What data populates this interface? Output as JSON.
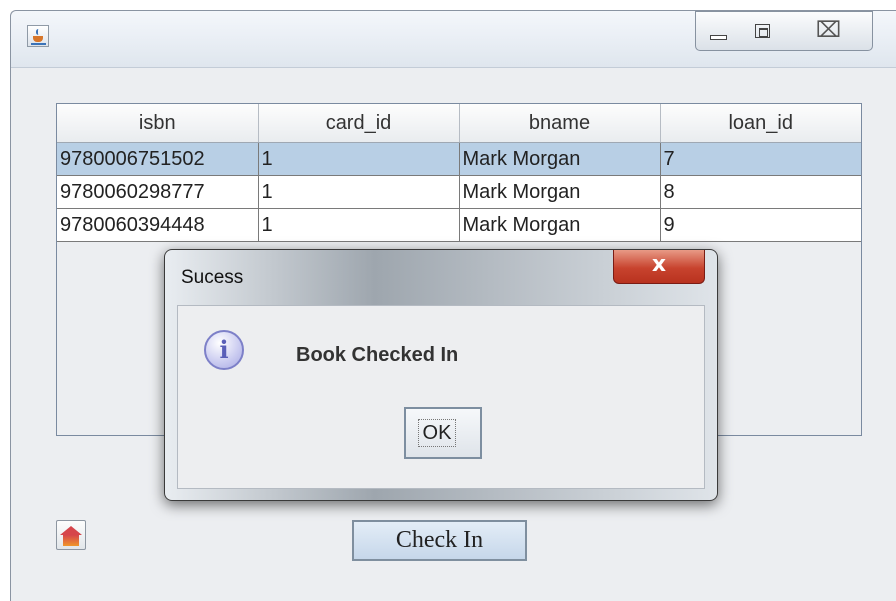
{
  "window": {
    "icon": "java-cup-icon",
    "controls": {
      "minimize": "minimize-icon",
      "maximize": "maximize-icon",
      "close_glyph": "⌧"
    }
  },
  "table": {
    "headers": [
      "isbn",
      "card_id",
      "bname",
      "loan_id"
    ],
    "rows": [
      {
        "isbn": "9780006751502",
        "card_id": "1",
        "bname": "Mark Morgan",
        "loan_id": "7",
        "selected": true
      },
      {
        "isbn": "9780060298777",
        "card_id": "1",
        "bname": "Mark Morgan",
        "loan_id": "8",
        "selected": false
      },
      {
        "isbn": "9780060394448",
        "card_id": "1",
        "bname": "Mark Morgan",
        "loan_id": "9",
        "selected": false
      }
    ],
    "selection_color": "#b8cfe5"
  },
  "footer": {
    "home_icon": "home-icon",
    "check_in_label": "Check In"
  },
  "dialog": {
    "title": "Sucess",
    "close_glyph": "x",
    "icon": "info-icon",
    "icon_glyph": "i",
    "message": "Book Checked In",
    "ok_label": "OK",
    "close_color": "#c8432e"
  }
}
